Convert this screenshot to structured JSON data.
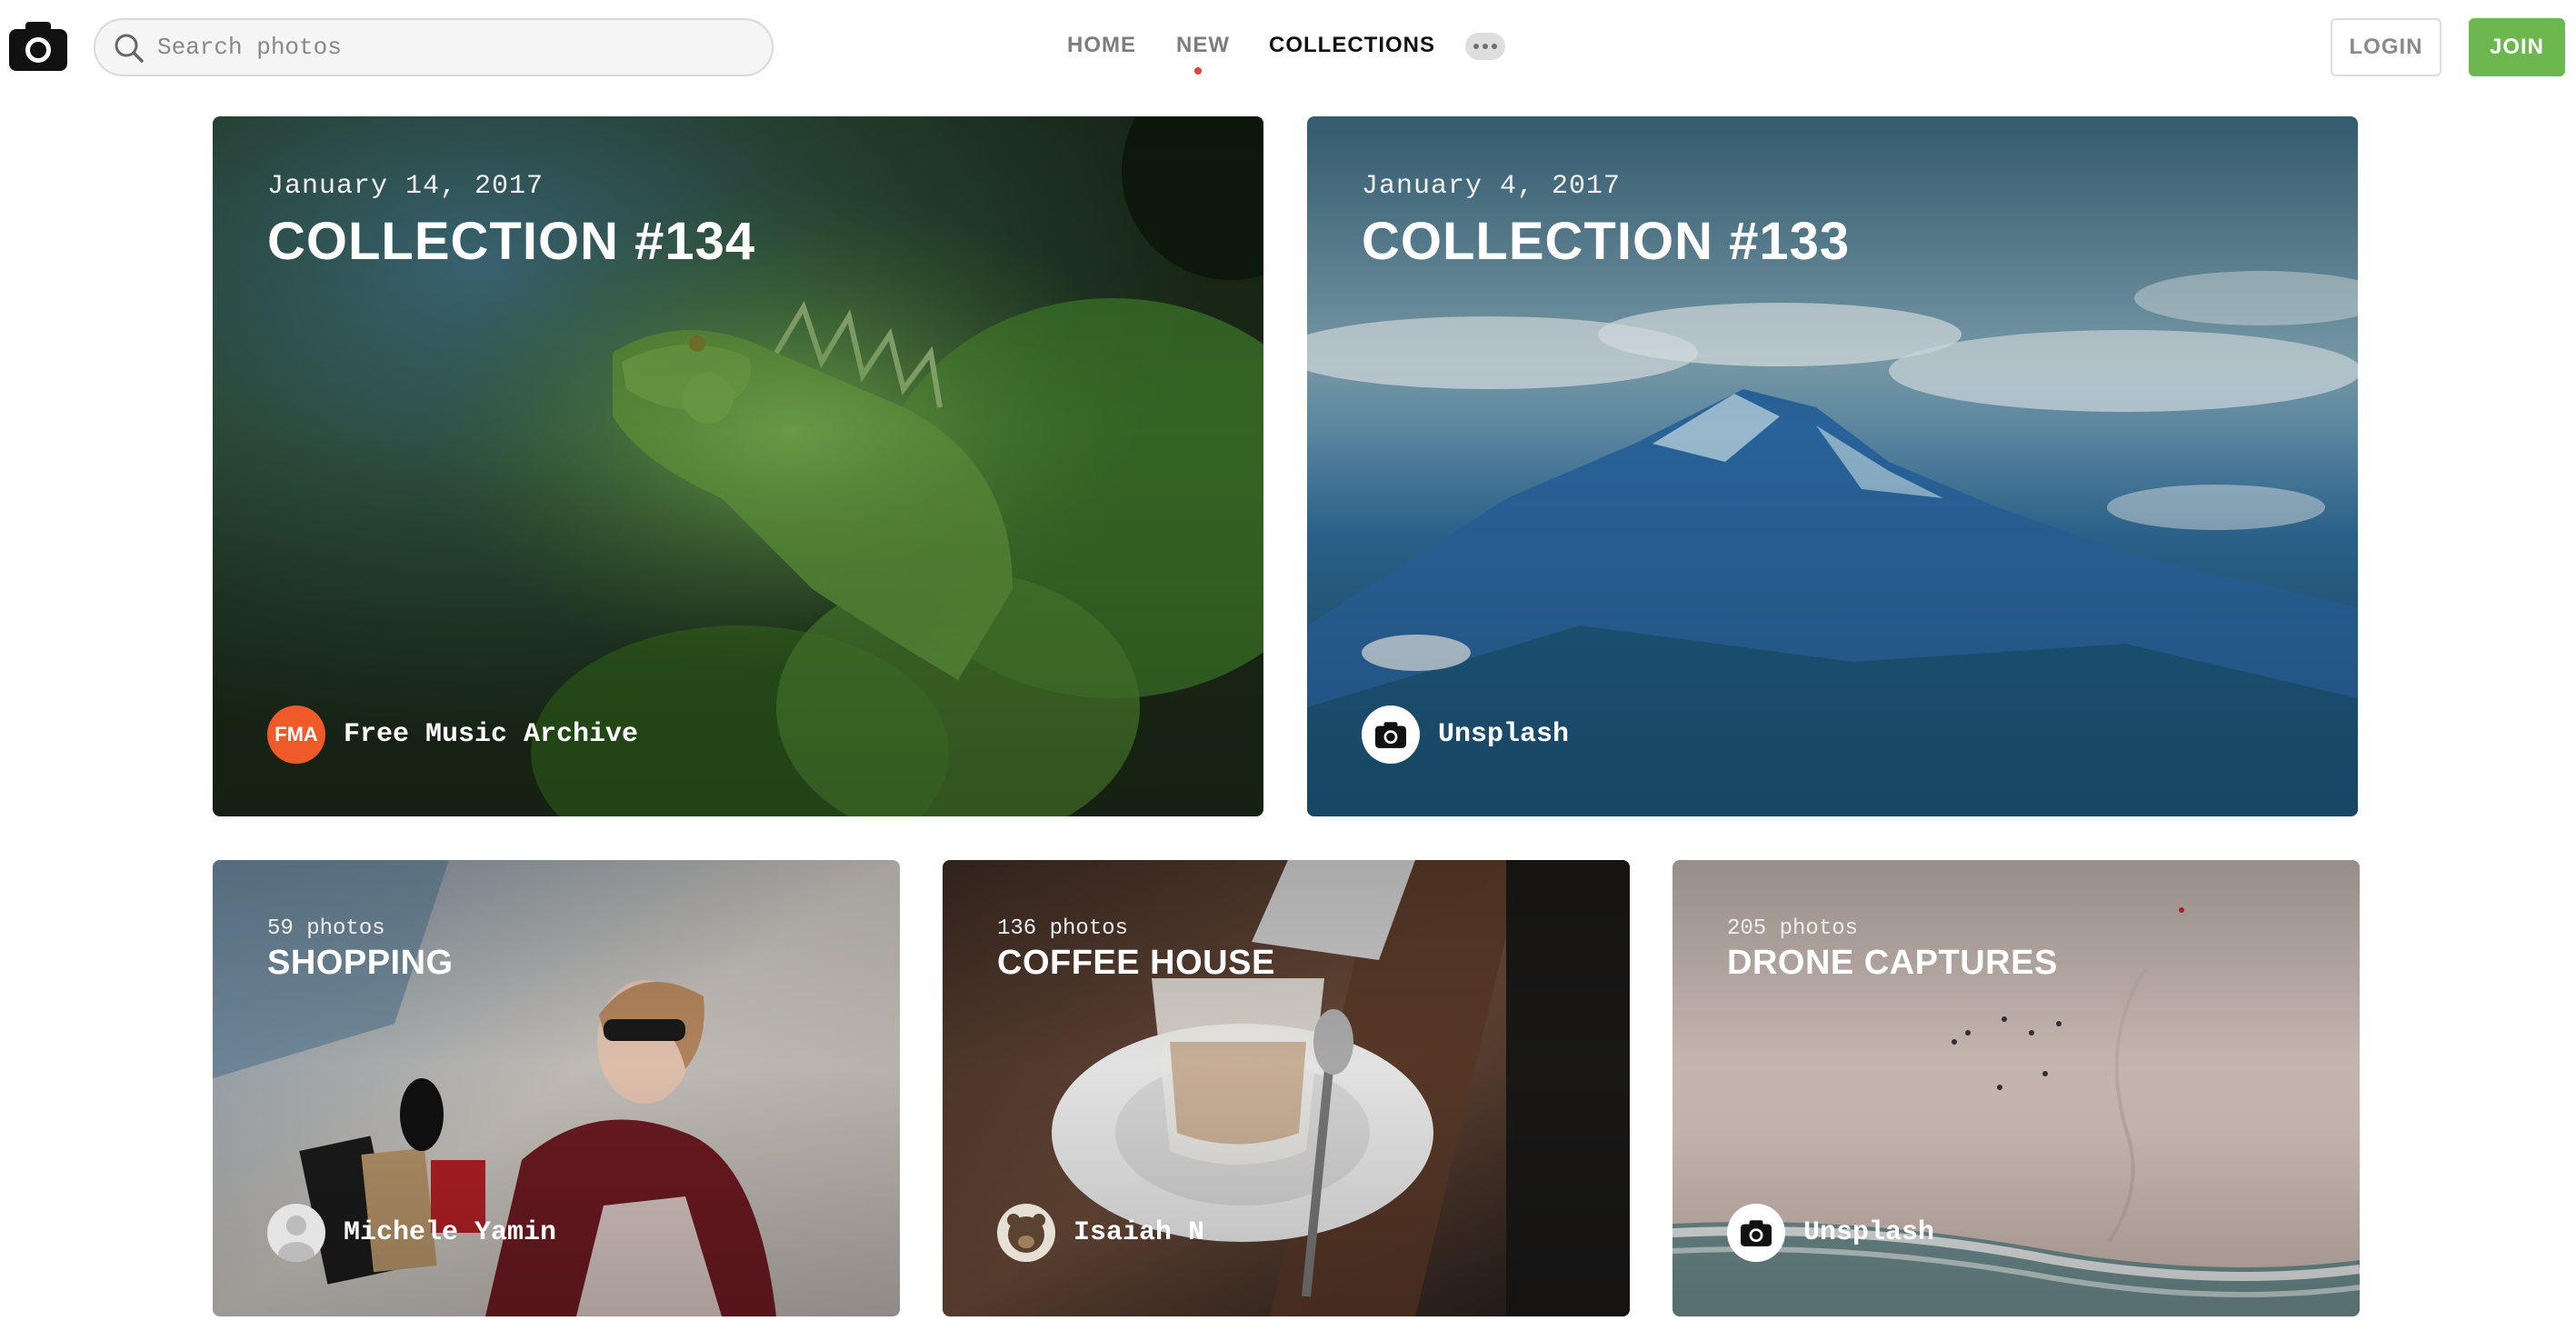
{
  "header": {
    "search_placeholder": "Search photos",
    "nav": {
      "home": "HOME",
      "new": "NEW",
      "collections": "COLLECTIONS"
    },
    "login": "LOGIN",
    "join": "JOIN"
  },
  "colors": {
    "accent_green": "#6cb84e",
    "new_dot": "#e0413a"
  },
  "featured": [
    {
      "date": "January 14, 2017",
      "title": "COLLECTION #134",
      "author": "Free Music Archive",
      "avatar_text": "FMA",
      "avatar_color": "#f05a28"
    },
    {
      "date": "January 4, 2017",
      "title": "COLLECTION #133",
      "author": "Unsplash"
    }
  ],
  "collections": [
    {
      "count": "59 photos",
      "title": "SHOPPING",
      "author": "Michele Yamin"
    },
    {
      "count": "136 photos",
      "title": "COFFEE HOUSE",
      "author": "Isaiah N"
    },
    {
      "count": "205 photos",
      "title": "DRONE CAPTURES",
      "author": "Unsplash"
    }
  ],
  "icons": {
    "logo": "camera-icon",
    "search": "search-icon",
    "more": "more-dots-icon"
  }
}
